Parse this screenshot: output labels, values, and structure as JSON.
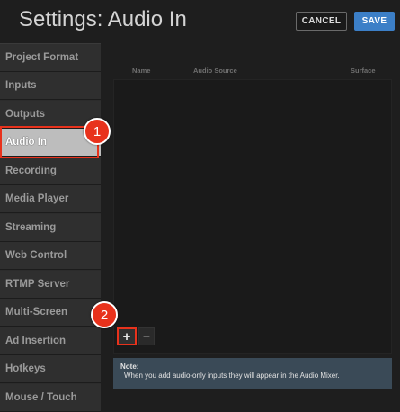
{
  "header": {
    "title": "Settings: Audio In",
    "cancel_label": "CANCEL",
    "save_label": "SAVE"
  },
  "sidebar": {
    "items": [
      {
        "label": "Project Format"
      },
      {
        "label": "Inputs"
      },
      {
        "label": "Outputs"
      },
      {
        "label": "Audio In",
        "active": true
      },
      {
        "label": "Recording"
      },
      {
        "label": "Media Player"
      },
      {
        "label": "Streaming"
      },
      {
        "label": "Web Control"
      },
      {
        "label": "RTMP Server"
      },
      {
        "label": "Multi-Screen"
      },
      {
        "label": "Ad Insertion"
      },
      {
        "label": "Hotkeys"
      },
      {
        "label": "Mouse / Touch"
      }
    ]
  },
  "table": {
    "columns": [
      "Name",
      "Audio Source",
      "Surface"
    ],
    "rows": []
  },
  "controls": {
    "add_label": "+",
    "remove_label": "−"
  },
  "note": {
    "label": "Note:",
    "text": "When you add audio-only inputs they will appear in the Audio Mixer."
  },
  "callouts": [
    "1",
    "2"
  ],
  "colors": {
    "accent_highlight": "#e8321c",
    "save_button": "#3c7fc7",
    "note_background": "#3a4a57",
    "active_item": "#bdbdbd"
  },
  "icons": {
    "add": "plus-icon",
    "remove": "minus-icon"
  }
}
